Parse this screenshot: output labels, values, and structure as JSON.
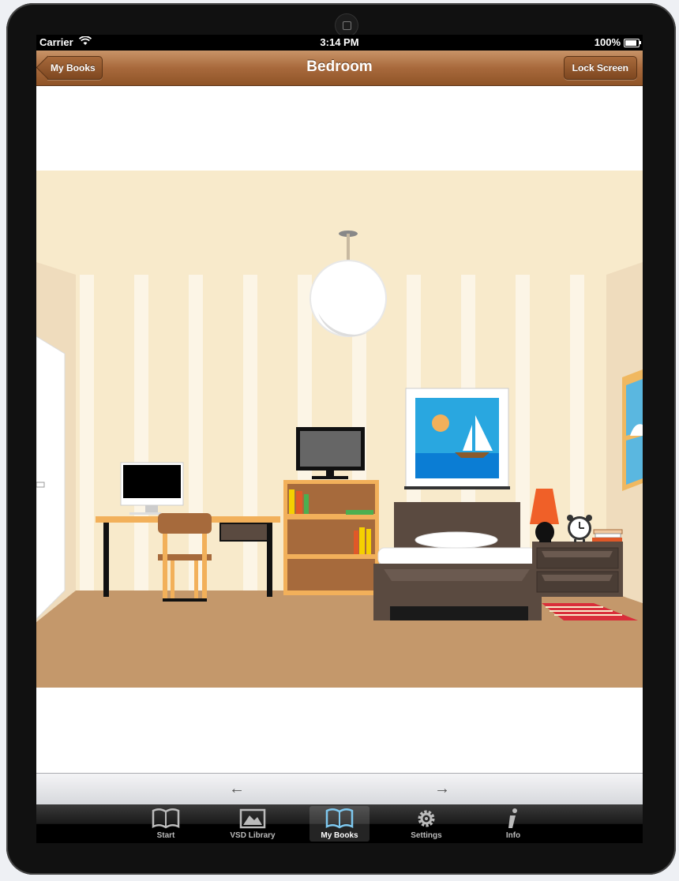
{
  "status_bar": {
    "carrier": "Carrier",
    "time": "3:14 PM",
    "battery": "100%",
    "battery_level": 1.0
  },
  "nav_bar": {
    "title": "Bedroom",
    "back_label": "My Books",
    "right_label": "Lock Screen"
  },
  "page_arrows": {
    "previous": "←",
    "next": "→"
  },
  "tab_bar": {
    "tabs": [
      {
        "label": "Start",
        "icon": "book-icon"
      },
      {
        "label": "VSD Library",
        "icon": "picture-icon"
      },
      {
        "label": "My Books",
        "icon": "book-icon",
        "selected": true
      },
      {
        "label": "Settings",
        "icon": "gear-icon"
      },
      {
        "label": "Info",
        "icon": "info-icon"
      }
    ]
  },
  "colors": {
    "nav_bar": "#a8693c",
    "tab_active": "#7ec8ef",
    "wall": "#f8eacb",
    "floor": "#c4986b"
  }
}
